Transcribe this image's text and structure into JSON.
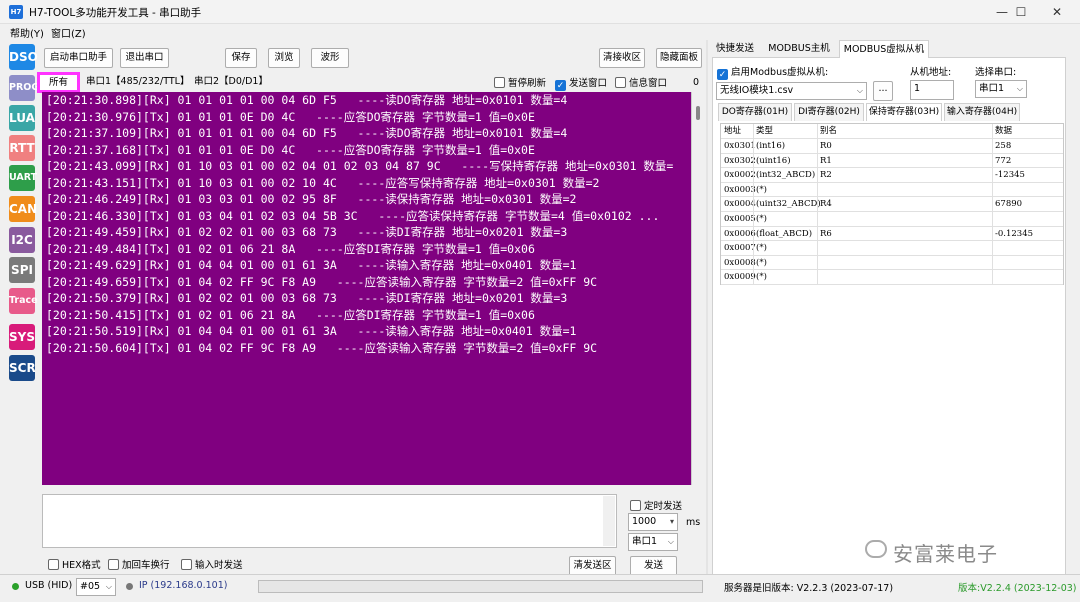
{
  "window": {
    "title": "H7-TOOL多功能开发工具 - 串口助手",
    "app_icon": "H7",
    "minimize": "—",
    "maximize": "☐",
    "close": "✕"
  },
  "menu": [
    "帮助(Y)",
    "窗口(Z)"
  ],
  "sidebar": [
    {
      "label": "DSO",
      "color": "#1e88e5"
    },
    {
      "label": "PROG",
      "color": "#8e8ec8"
    },
    {
      "label": "LUA",
      "color": "#3aa6a6"
    },
    {
      "label": "RTT",
      "color": "#f08080"
    },
    {
      "label": "UART",
      "color": "#2e9e4a"
    },
    {
      "label": "CAN",
      "color": "#f08c1a"
    },
    {
      "label": "I2C",
      "color": "#8a5a9e"
    },
    {
      "label": "SPI",
      "color": "#7a7a7a"
    },
    {
      "label": "Trace",
      "color": "#e85a8a"
    },
    {
      "label": "SYS",
      "color": "#d81b7a"
    },
    {
      "label": "SCR",
      "color": "#1a4a8a"
    }
  ],
  "toolbar": {
    "start": "启动串口助手",
    "exit": "退出串口",
    "save": "保存",
    "browse": "浏览",
    "wave": "波形",
    "clear_rx": "清接收区",
    "hide_panel": "隐藏面板"
  },
  "log_tabs": {
    "all": "所有",
    "port1": "串口1【485/232/TTL】",
    "port2": "串口2【D0/D1】"
  },
  "log_opts": {
    "pause": "暂停刷新",
    "show_tx": "发送窗口",
    "info": "信息窗口",
    "count": "0"
  },
  "log_lines": [
    "[20:21:30.898][Rx] 01 01 01 01 00 04 6D F5   ----读DO寄存器 地址=0x0101 数量=4",
    "[20:21:30.976][Tx] 01 01 01 0E D0 4C   ----应答DO寄存器 字节数量=1 值=0x0E",
    "[20:21:37.109][Rx] 01 01 01 01 00 04 6D F5   ----读DO寄存器 地址=0x0101 数量=4",
    "[20:21:37.168][Tx] 01 01 01 0E D0 4C   ----应答DO寄存器 字节数量=1 值=0x0E",
    "[20:21:43.099][Rx] 01 10 03 01 00 02 04 01 02 03 04 87 9C   ----写保持寄存器 地址=0x0301 数量=",
    "[20:21:43.151][Tx] 01 10 03 01 00 02 10 4C   ----应答写保持寄存器 地址=0x0301 数量=2",
    "[20:21:46.249][Rx] 01 03 03 01 00 02 95 8F   ----读保持寄存器 地址=0x0301 数量=2",
    "[20:21:46.330][Tx] 01 03 04 01 02 03 04 5B 3C   ----应答读保持寄存器 字节数量=4 值=0x0102 ...",
    "[20:21:49.459][Rx] 01 02 02 01 00 03 68 73   ----读DI寄存器 地址=0x0201 数量=3",
    "[20:21:49.484][Tx] 01 02 01 06 21 8A   ----应答DI寄存器 字节数量=1 值=0x06",
    "[20:21:49.629][Rx] 01 04 04 01 00 01 61 3A   ----读输入寄存器 地址=0x0401 数量=1",
    "[20:21:49.659][Tx] 01 04 02 FF 9C F8 A9   ----应答读输入寄存器 字节数量=2 值=0xFF 9C",
    "[20:21:50.379][Rx] 01 02 02 01 00 03 68 73   ----读DI寄存器 地址=0x0201 数量=3",
    "[20:21:50.415][Tx] 01 02 01 06 21 8A   ----应答DI寄存器 字节数量=1 值=0x06",
    "[20:21:50.519][Rx] 01 04 04 01 00 01 61 3A   ----读输入寄存器 地址=0x0401 数量=1",
    "[20:21:50.604][Tx] 01 04 02 FF 9C F8 A9   ----应答读输入寄存器 字节数量=2 值=0xFF 9C"
  ],
  "send": {
    "timed": "定时发送",
    "interval": "1000",
    "unit": "ms",
    "port": "串口1",
    "hex": "HEX格式",
    "crlf": "加回车换行",
    "on_input": "输入时发送",
    "clear": "清发送区",
    "send": "发送"
  },
  "status": {
    "usb": "USB (HID)",
    "dev": "#05",
    "ip": "IP (192.168.0.101)",
    "server": "服务器是旧版本: V2.2.3 (2023-07-17)",
    "version": "版本:V2.2.4 (2023-12-03)"
  },
  "right_tabs": [
    "快捷发送",
    "MODBUS主机",
    "MODBUS虚拟从机"
  ],
  "slave": {
    "enable": "启用Modbus虚拟从机:",
    "addr_label": "从机地址:",
    "port_label": "选择串口:",
    "file": "无线IO模块1.csv",
    "more": "...",
    "addr": "1",
    "port": "串口1"
  },
  "reg_tabs": [
    "DO寄存器(01H)",
    "DI寄存器(02H)",
    "保持寄存器(03H)",
    "输入寄存器(04H)"
  ],
  "grid": {
    "headers": [
      "地址",
      "类型",
      "别名",
      "数据"
    ],
    "rows": [
      [
        "0x0301",
        "(int16)",
        "R0",
        "258"
      ],
      [
        "0x0302",
        "(uint16)",
        "R1",
        "772"
      ],
      [
        "0x0002",
        "(int32_ABCD)",
        "R2",
        "-12345"
      ],
      [
        "0x0003",
        "(*)",
        "",
        ""
      ],
      [
        "0x0004",
        "(uint32_ABCD)",
        "R4",
        "67890"
      ],
      [
        "0x0005",
        "(*)",
        "",
        ""
      ],
      [
        "0x0006",
        "(float_ABCD)",
        "R6",
        "-0.12345"
      ],
      [
        "0x0007",
        "(*)",
        "",
        ""
      ],
      [
        "0x0008",
        "(*)",
        "",
        ""
      ],
      [
        "0x0009",
        "(*)",
        "",
        ""
      ]
    ]
  },
  "watermark": "安富莱电子",
  "colors": {
    "log_bg": "#800080",
    "active_tab_border": "#ff33ff",
    "accent": "#1673d6",
    "version_green": "#2a9a2a"
  }
}
